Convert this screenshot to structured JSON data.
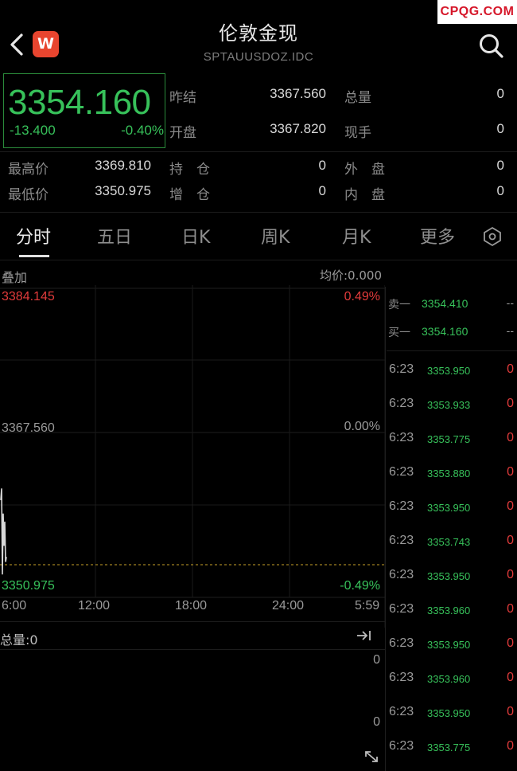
{
  "watermark": "CPQG.COM",
  "header": {
    "title": "伦敦金现",
    "subtitle": "SPTAUUSDOZ.IDC",
    "app_logo": "W",
    "icons": {
      "back": "chevron-left-icon",
      "search": "search-icon"
    }
  },
  "quote": {
    "last_price": "3354.160",
    "change": "-13.400",
    "change_pct": "-0.40%"
  },
  "stats": [
    {
      "label": "昨结",
      "value": "3367.560"
    },
    {
      "label": "开盘",
      "value": "3367.820"
    },
    {
      "label": "总量",
      "value": "0"
    },
    {
      "label": "现手",
      "value": "0"
    },
    {
      "label": "最高价",
      "value": "3369.810"
    },
    {
      "label": "最低价",
      "value": "3350.975"
    },
    {
      "label": "持　仓",
      "value": "0"
    },
    {
      "label": "增　仓",
      "value": "0"
    },
    {
      "label": "外　盘",
      "value": "0"
    },
    {
      "label": "内　盘",
      "value": "0"
    }
  ],
  "tabs": [
    {
      "label": "分时",
      "active": true
    },
    {
      "label": "五日"
    },
    {
      "label": "日K"
    },
    {
      "label": "周K"
    },
    {
      "label": "月K"
    },
    {
      "label": "更多"
    }
  ],
  "chart": {
    "overlay_label": "叠加",
    "avg_price_label": "均价:0.000",
    "y_top": "3384.145",
    "y_mid": "3367.560",
    "y_bottom": "3350.975",
    "pct_top": "0.49%",
    "pct_mid": "0.00%",
    "pct_bottom": "-0.49%",
    "x_labels": [
      "6:00",
      "12:00",
      "18:00",
      "24:00",
      "5:59"
    ],
    "volume_label": "总量:0",
    "volume_top": "0",
    "volume_mid": "0",
    "colors": {
      "up": "#e23b3b",
      "down": "#37c15a",
      "line": "#d8d8d8",
      "prev_close": "#c9a227"
    }
  },
  "chart_data": {
    "type": "line",
    "x": [
      "6:00",
      "6:23"
    ],
    "values": [
      3367.82,
      3354.16
    ],
    "ylim": [
      3350.975,
      3384.145
    ],
    "reference": 3367.56
  },
  "order_book": {
    "asks": [
      {
        "label": "卖一",
        "price": "3354.410",
        "volume": "--"
      }
    ],
    "bids": [
      {
        "label": "买一",
        "price": "3354.160",
        "volume": "--"
      }
    ]
  },
  "ticks": [
    {
      "time": "6:23",
      "price": "3353.950",
      "volume": "0"
    },
    {
      "time": "6:23",
      "price": "3353.933",
      "volume": "0"
    },
    {
      "time": "6:23",
      "price": "3353.775",
      "volume": "0"
    },
    {
      "time": "6:23",
      "price": "3353.880",
      "volume": "0"
    },
    {
      "time": "6:23",
      "price": "3353.950",
      "volume": "0"
    },
    {
      "time": "6:23",
      "price": "3353.743",
      "volume": "0"
    },
    {
      "time": "6:23",
      "price": "3353.950",
      "volume": "0"
    },
    {
      "time": "6:23",
      "price": "3353.960",
      "volume": "0"
    },
    {
      "time": "6:23",
      "price": "3353.950",
      "volume": "0"
    },
    {
      "time": "6:23",
      "price": "3353.960",
      "volume": "0"
    },
    {
      "time": "6:23",
      "price": "3353.950",
      "volume": "0"
    },
    {
      "time": "6:23",
      "price": "3353.775",
      "volume": "0"
    }
  ]
}
